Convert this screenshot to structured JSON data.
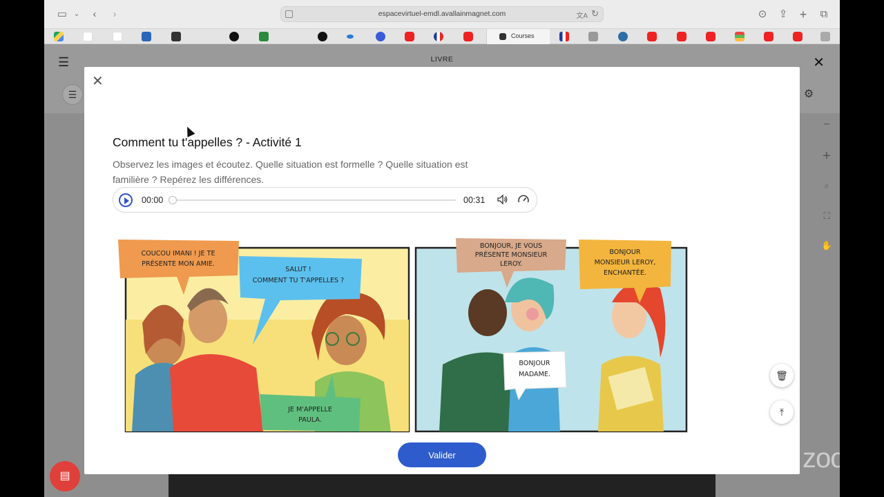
{
  "browser": {
    "url": "espacevirtuel-emdl.avallainmagnet.com",
    "courses_tab_label": "Courses"
  },
  "app": {
    "header_title": "LIVRE"
  },
  "activity": {
    "title": "Comment tu t'appelles ? - Activité 1",
    "instructions": "Observez les images et écoutez. Quelle situation est formelle ? Quelle situation est familière ? Repérez les différences.",
    "audio": {
      "current_time": "00:00",
      "duration": "00:31",
      "progress": 0
    },
    "comic": {
      "panel1": {
        "bubble1": [
          "COUCOU IMANI ! JE TE",
          "PRÉSENTE MON AMIE."
        ],
        "bubble2": [
          "SALUT !",
          "COMMENT TU T'APPELLES ?"
        ],
        "bubble3": [
          "JE M'APPELLE",
          "PAULA."
        ]
      },
      "panel2": {
        "bubble1": [
          "BONJOUR, JE VOUS",
          "PRÉSENTE MONSIEUR",
          "LEROY."
        ],
        "bubble2": [
          "BONJOUR",
          "MONSIEUR LEROY,",
          "ENCHANTÉE."
        ],
        "bubble3": [
          "BONJOUR",
          "MADAME."
        ]
      }
    },
    "validate_label": "Valider"
  },
  "colors": {
    "primary": "#2f5ccd",
    "chat_button": "#e0403a",
    "bubble_orange": "#ef9a4e",
    "bubble_blue": "#5cc0ee",
    "bubble_green": "#5fbf7f",
    "bubble_tan": "#d8a98a",
    "bubble_yellow": "#f3b53d"
  },
  "icons": [
    "sidebar-icon",
    "back-icon",
    "forward-icon",
    "download-icon",
    "share-icon",
    "new-tab-icon",
    "tabs-icon",
    "menu-icon",
    "close-icon",
    "play-icon",
    "volume-icon",
    "speed-icon",
    "trash-icon",
    "upload-icon",
    "chat-icon"
  ]
}
